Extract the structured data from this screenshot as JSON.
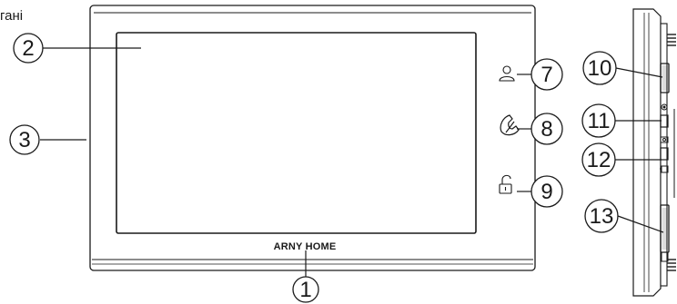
{
  "corner_fragment": "гані",
  "brand_label": "ARNY HOME",
  "callouts": {
    "c1": "1",
    "c2": "2",
    "c3": "3",
    "c7": "7",
    "c8": "8",
    "c9": "9",
    "c10": "10",
    "c11": "11",
    "c12": "12",
    "c13": "13"
  },
  "icons": [
    "person-icon",
    "handset-icon",
    "unlock-icon",
    "gear-icon",
    "camera-icon"
  ]
}
